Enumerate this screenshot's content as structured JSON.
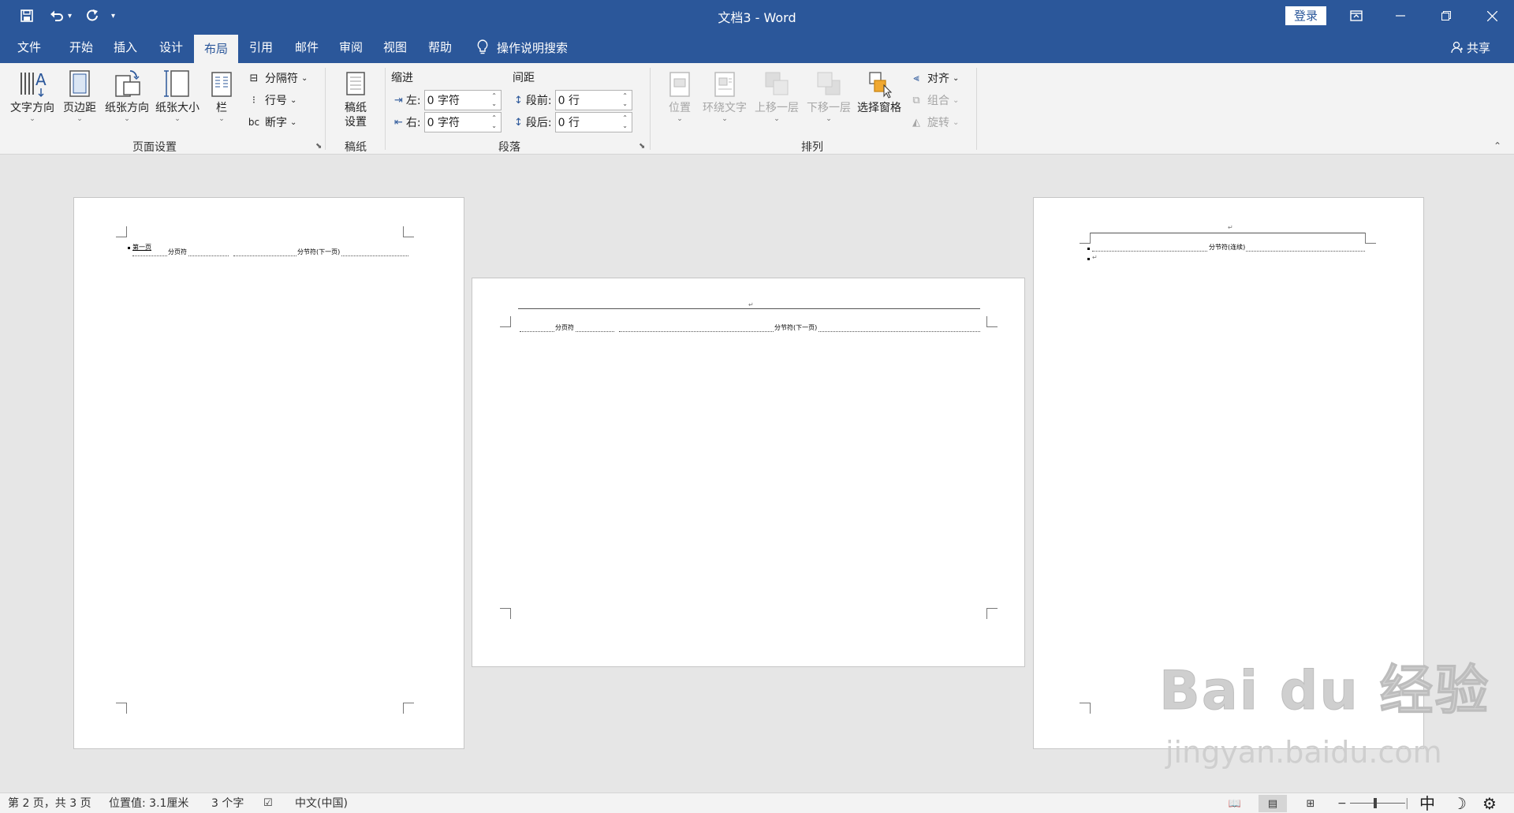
{
  "window": {
    "title": "文档3 - Word",
    "login_label": "登录"
  },
  "qat": {
    "save_icon": "save-icon",
    "undo_icon": "undo-icon",
    "redo_icon": "redo-icon"
  },
  "tabs": [
    {
      "label": "文件"
    },
    {
      "label": "开始"
    },
    {
      "label": "插入"
    },
    {
      "label": "设计"
    },
    {
      "label": "布局"
    },
    {
      "label": "引用"
    },
    {
      "label": "邮件"
    },
    {
      "label": "审阅"
    },
    {
      "label": "视图"
    },
    {
      "label": "帮助"
    }
  ],
  "search": {
    "label": "操作说明搜索"
  },
  "share": {
    "label": "共享"
  },
  "ribbon": {
    "page_setup": {
      "label": "页面设置",
      "text_direction": "文字方向",
      "margins": "页边距",
      "orientation": "纸张方向",
      "size": "纸张大小",
      "columns": "栏",
      "breaks": "分隔符",
      "line_numbers": "行号",
      "hyphenation": "断字"
    },
    "manuscript": {
      "label": "稿纸",
      "button_line1": "稿纸",
      "button_line2": "设置"
    },
    "paragraph": {
      "label": "段落",
      "indent_title": "缩进",
      "spacing_title": "间距",
      "left_label": "左:",
      "left_value": "0 字符",
      "right_label": "右:",
      "right_value": "0 字符",
      "before_label": "段前:",
      "before_value": "0 行",
      "after_label": "段后:",
      "after_value": "0 行"
    },
    "arrange": {
      "label": "排列",
      "position": "位置",
      "wrap_text": "环绕文字",
      "bring_forward": "上移一层",
      "send_backward": "下移一层",
      "selection_pane": "选择窗格",
      "align": "对齐",
      "group": "组合",
      "rotate": "旋转"
    }
  },
  "pages": {
    "page1": {
      "heading": "第一页",
      "page_break": "分页符",
      "section_break": "分节符(下一页)"
    },
    "page2": {
      "page_break": "分页符",
      "section_break": "分节符(下一页)"
    },
    "page3": {
      "section_break": "分节符(连续)"
    }
  },
  "statusbar": {
    "page_info": "第 2 页，共 3 页",
    "position": "位置值: 3.1厘米",
    "word_count": "3 个字",
    "language": "中文(中国)",
    "ime": "中"
  },
  "watermark": {
    "main": "Bai du 经验",
    "sub": "jingyan.baidu.com"
  }
}
